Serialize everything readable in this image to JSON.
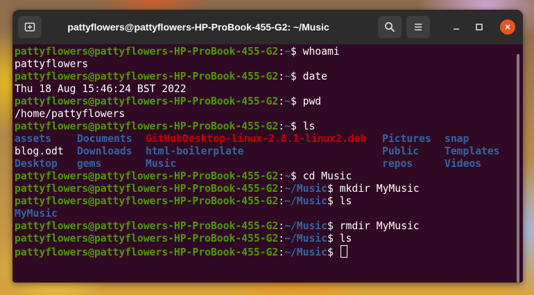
{
  "window": {
    "title": "pattyflowers@pattyflowers-HP-ProBook-455-G2: ~/Music",
    "icons": {
      "new_tab": "new-tab-icon",
      "search": "search-icon",
      "menu": "hamburger-menu-icon",
      "minimize": "minimize-icon",
      "maximize": "maximize-icon",
      "close": "close-icon"
    }
  },
  "colors": {
    "terminal_bg": "#300a24",
    "prompt_user": "#4e9a06",
    "prompt_path": "#3465a4",
    "directory": "#3465a4",
    "archive": "#cc0000",
    "close_button": "#e9541f"
  },
  "prompt": {
    "userhost": "pattyflowers@pattyflowers-HP-ProBook-455-G2",
    "sep": ":",
    "home_path": "~",
    "music_path": "~/Music",
    "symbol": "$ "
  },
  "terminal": {
    "commands": {
      "whoami": "whoami",
      "date": "date",
      "pwd": "pwd",
      "ls1": "ls",
      "cd": "cd Music",
      "mkdir": "mkdir MyMusic",
      "ls2": "ls",
      "rmdir": "rmdir MyMusic",
      "ls3": "ls"
    },
    "outputs": {
      "whoami": "pattyflowers",
      "date": "Thu 18 Aug 15:46:24 BST 2022",
      "pwd": "/home/pattyflowers",
      "ls2": "MyMusic"
    },
    "ls_home": {
      "col1": [
        "assets",
        "blog.odt",
        "Desktop"
      ],
      "col2": [
        "Documents",
        "Downloads",
        "gems"
      ],
      "col3": [
        "GitHubDesktop-linux-2.8.1-linux2.deb",
        "html-boilerplate",
        "Music"
      ],
      "col4": [
        "Pictures",
        "Public",
        "repos"
      ],
      "col5": [
        "snap",
        "Templates",
        "Videos"
      ]
    }
  }
}
